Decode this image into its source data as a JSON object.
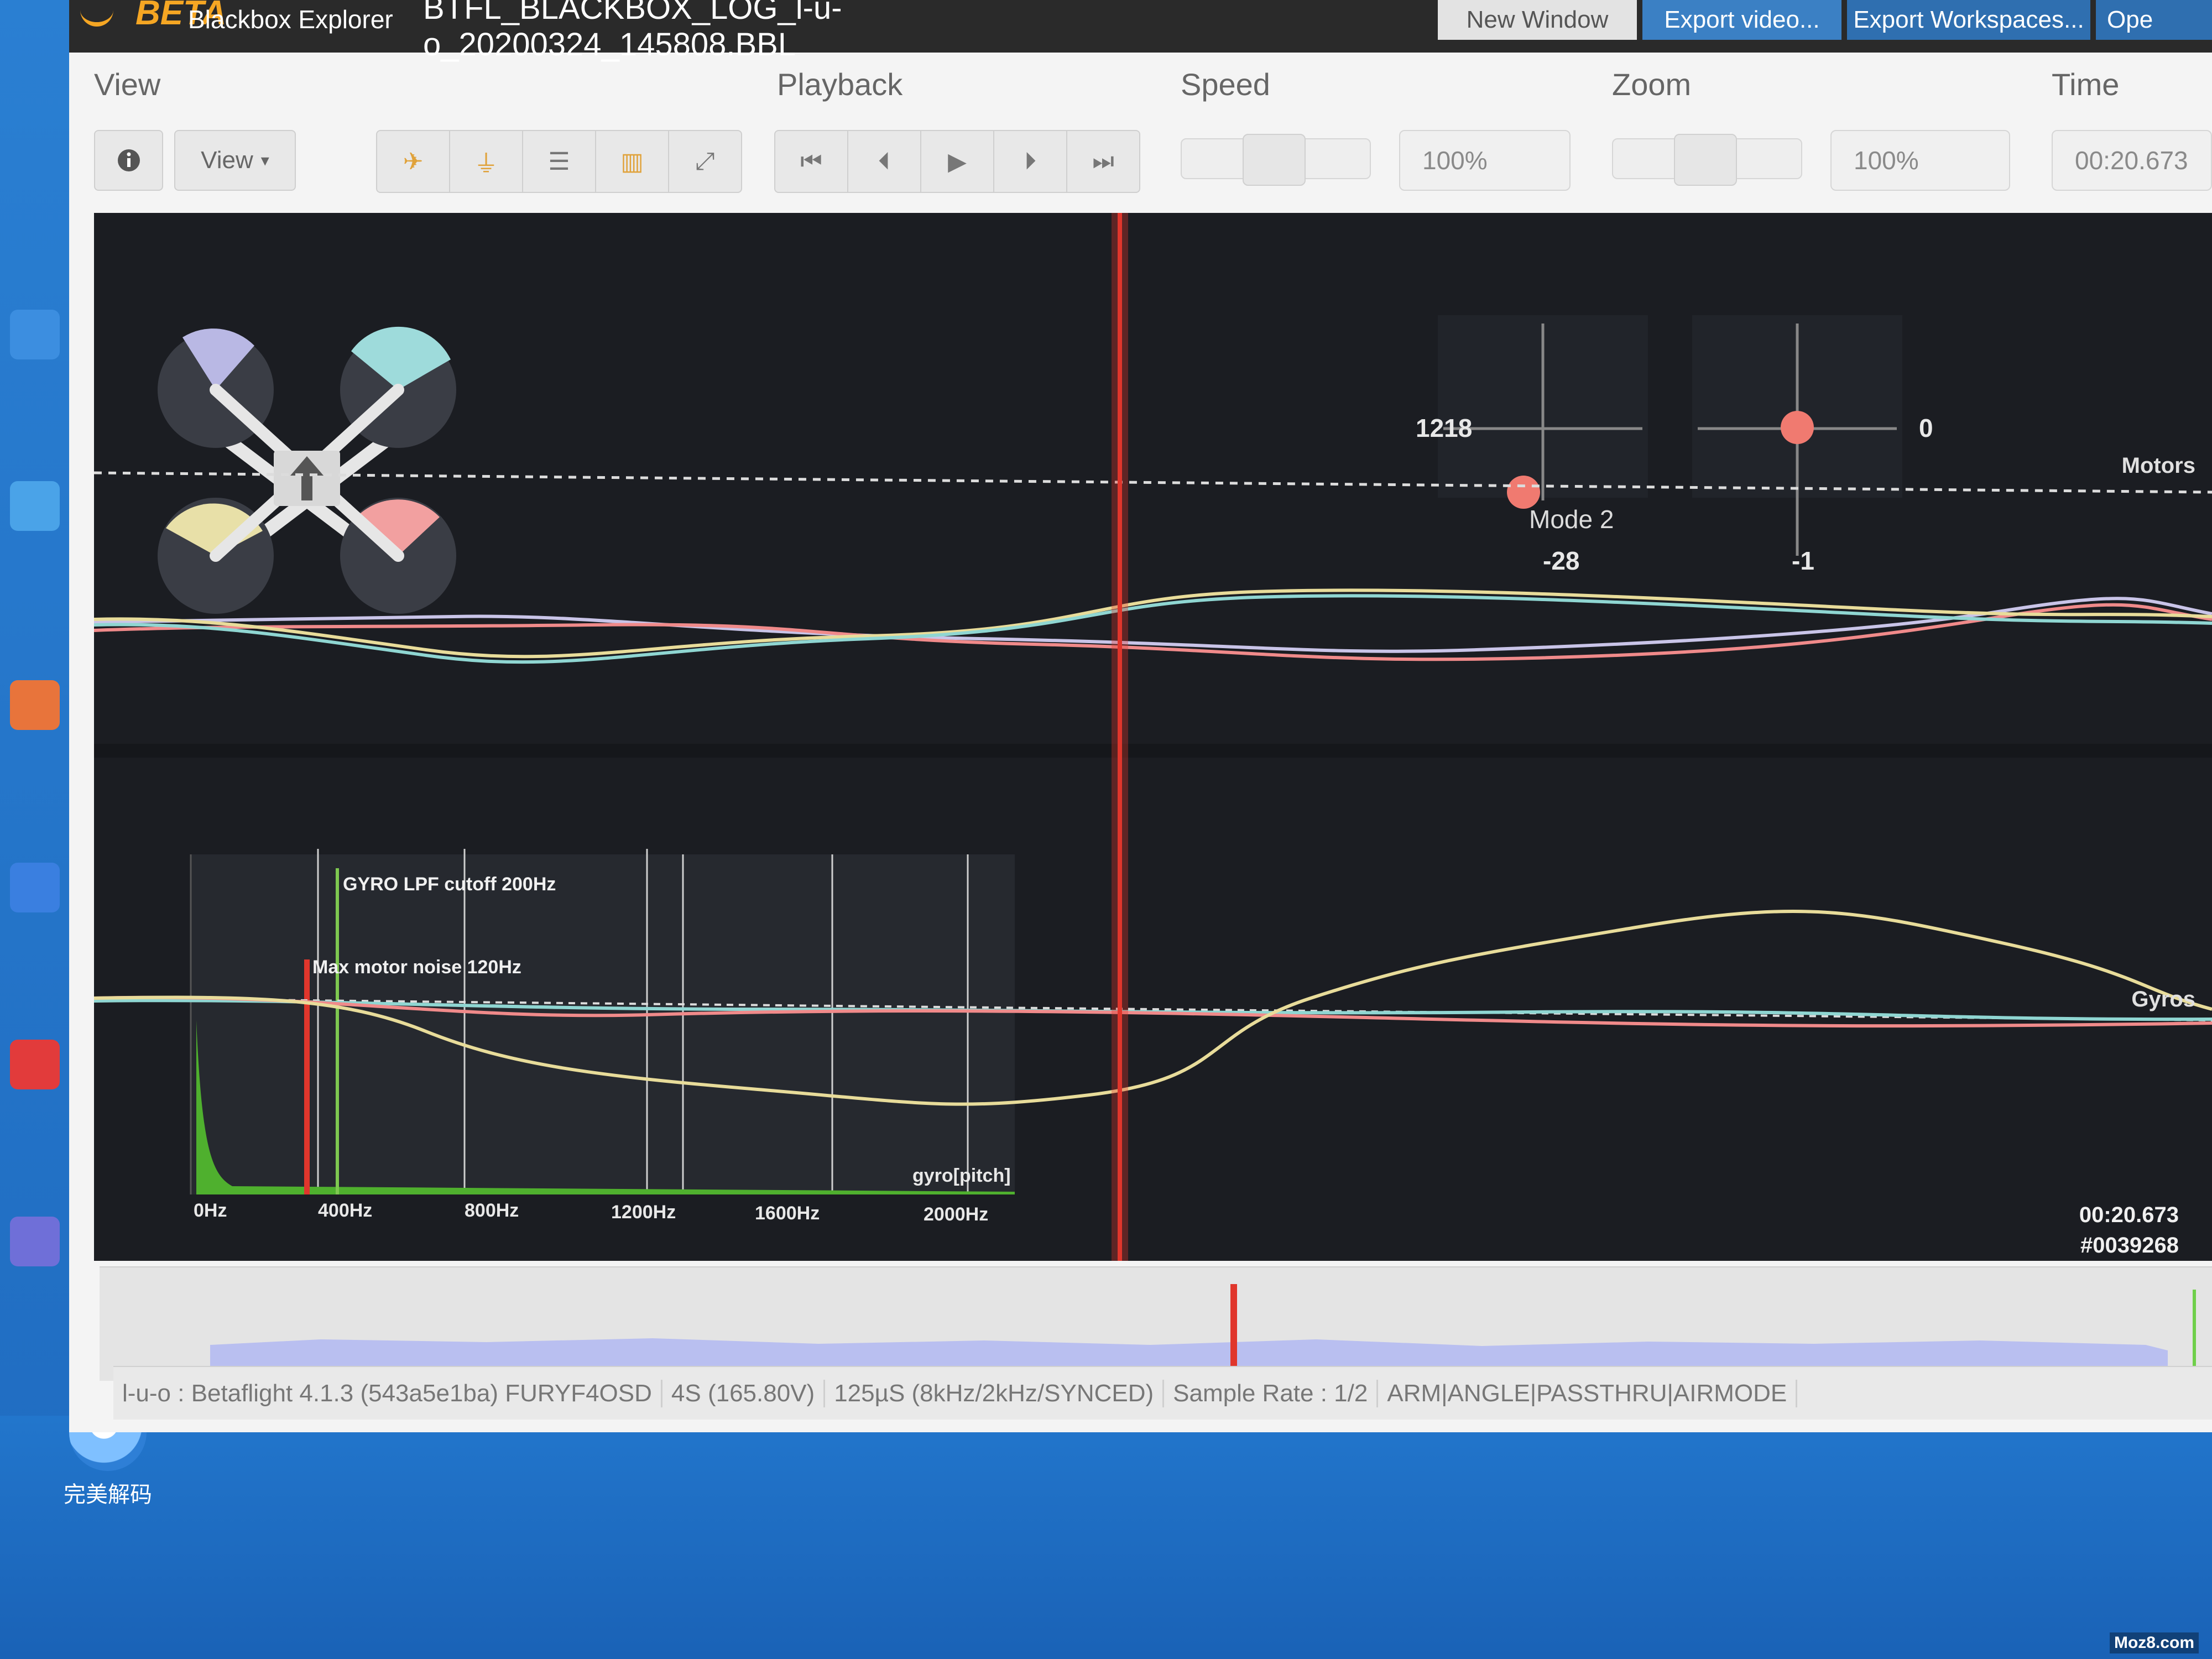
{
  "desktop": {
    "bottom_app_label": "完美解码",
    "watermark": "Moz8.com"
  },
  "titlebar": {
    "brand_badge": "BETA",
    "brand_name": "Blackbox Explorer",
    "log_file": "BTFL_BLACKBOX_LOG_l-u-o_20200324_145808.BBL",
    "buttons": [
      "New Window",
      "Export video...",
      "Export Workspaces...",
      "Ope"
    ]
  },
  "toolbar": {
    "view_label": "View",
    "view_dropdown": "View",
    "playback_label": "Playback",
    "speed_label": "Speed",
    "speed_value": "100%",
    "zoom_label": "Zoom",
    "zoom_value": "100%",
    "time_label": "Time",
    "time_value": "00:20.673",
    "view_icons": [
      "craft-icon",
      "sticks-icon",
      "table-icon",
      "analyser-icon",
      "fullscreen-icon"
    ],
    "playback_icons": [
      "skip-start-icon",
      "step-back-icon",
      "play-icon",
      "step-forward-icon",
      "skip-end-icon"
    ]
  },
  "graph": {
    "sticks": {
      "left_throttle": "1218",
      "left_yaw": "-28",
      "mode": "Mode 2",
      "right_roll": "0",
      "right_pitch": "-1"
    },
    "labels": {
      "motors": "Motors",
      "gyros": "Gyros",
      "gyro_lpf": "GYRO LPF cutoff 200Hz",
      "max_motor_noise": "Max motor noise 120Hz",
      "analyser_series": "gyro[pitch]"
    },
    "analyser_ticks": [
      "0Hz",
      "400Hz",
      "800Hz",
      "1200Hz",
      "1600Hz",
      "2000Hz"
    ],
    "cursor_time": "00:20.673",
    "cursor_frame": "#0039268",
    "colors": {
      "yellow": "#e8dc9a",
      "cyan": "#8fd6d2",
      "pink": "#f08a8a",
      "lavender": "#c9c4e8",
      "cursor": "#e0362c",
      "lpf_line": "#7ec850",
      "noise_line": "#e0362c"
    }
  },
  "statusbar": [
    "l-u-o : Betaflight 4.1.3 (543a5e1ba) FURYF4OSD",
    "4S (165.80V)",
    "125µS (8kHz/2kHz/SYNCED)",
    "Sample Rate : 1/2",
    "ARM|ANGLE|PASSTHRU|AIRMODE"
  ]
}
